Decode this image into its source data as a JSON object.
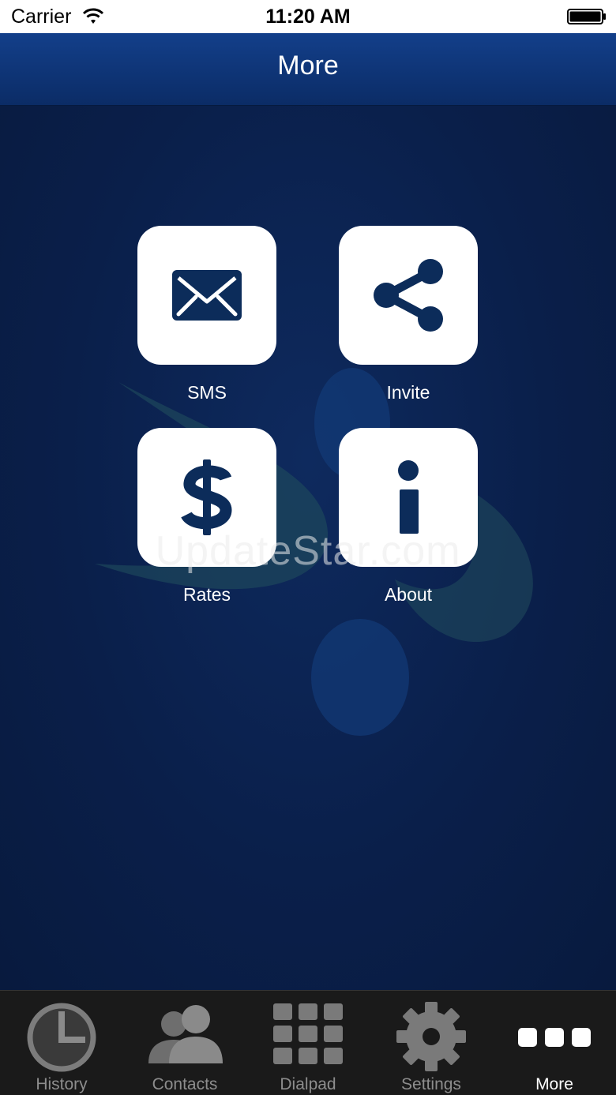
{
  "status_bar": {
    "carrier": "Carrier",
    "time": "11:20 AM"
  },
  "nav": {
    "title": "More"
  },
  "tiles": [
    {
      "label": "SMS",
      "icon": "envelope-icon"
    },
    {
      "label": "Invite",
      "icon": "share-icon"
    },
    {
      "label": "Rates",
      "icon": "dollar-icon"
    },
    {
      "label": "About",
      "icon": "info-icon"
    }
  ],
  "watermark": "UpdateStar.com",
  "tab_bar": {
    "items": [
      {
        "label": "History",
        "icon": "clock-icon"
      },
      {
        "label": "Contacts",
        "icon": "contacts-icon"
      },
      {
        "label": "Dialpad",
        "icon": "dialpad-icon"
      },
      {
        "label": "Settings",
        "icon": "gear-icon"
      },
      {
        "label": "More",
        "icon": "more-dots-icon",
        "active": true
      }
    ]
  },
  "colors": {
    "nav": "#133f8a",
    "background": "#0a1f4a",
    "icon": "#0c2c5a",
    "tab_active": "#ffffff",
    "tab_inactive": "#8d8d8d"
  }
}
